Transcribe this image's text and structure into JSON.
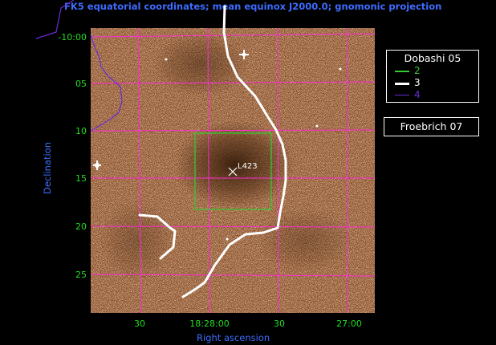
{
  "figure": {
    "title": "FK5 equatorial coordinates; mean equinox J2000.0; gnomonic projection",
    "xlabel": "Right ascension",
    "ylabel": "Declination",
    "x_ticks": [
      "30",
      "18:28:00",
      "30",
      "27:00"
    ],
    "y_ticks": [
      "-10:00",
      "05",
      "10",
      "15",
      "20",
      "25"
    ],
    "object_label": "L423",
    "colors": {
      "axis_text": "#3d6cff",
      "tick_text": "#22dd22",
      "grid": "#ff2bd6",
      "contour_2": "#33cc33",
      "contour_3": "#ffffff",
      "contour_4": "#6a2bd8",
      "background": "#000000"
    }
  },
  "legend_dobashi": {
    "title": "Dobashi 05",
    "entries": [
      {
        "label": "2",
        "color": "#33cc33"
      },
      {
        "label": "3",
        "color": "#ffffff"
      },
      {
        "label": "4",
        "color": "#6a2bd8"
      }
    ]
  },
  "legend_froebrich": {
    "title": "Froebrich 07"
  }
}
